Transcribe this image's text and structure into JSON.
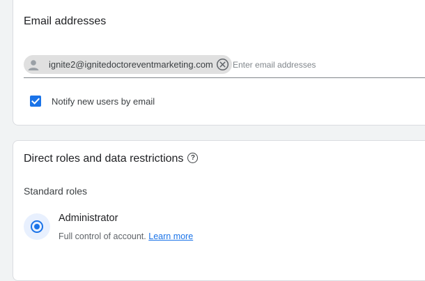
{
  "email_section": {
    "title": "Email addresses",
    "chip_email": "ignite2@ignitedoctoreventmarketing.com",
    "input_placeholder": "Enter email addresses",
    "notify_label": "Notify new users by email",
    "notify_checked": true
  },
  "roles_section": {
    "title": "Direct roles and data restrictions",
    "standard_roles_label": "Standard roles",
    "role": {
      "name": "Administrator",
      "description": "Full control of account.",
      "learn_more": "Learn more",
      "selected": true
    }
  },
  "colors": {
    "accent": "#1a73e8",
    "chip_bg": "#e0e0e0",
    "card_border": "#dadce0",
    "page_bg": "#f1f3f4"
  },
  "icons": {
    "chip_avatar": "person-icon",
    "chip_remove": "cancel-circle-icon",
    "checkbox": "check-icon",
    "help": "help-circle-icon",
    "radio": "radio-selected-icon"
  }
}
